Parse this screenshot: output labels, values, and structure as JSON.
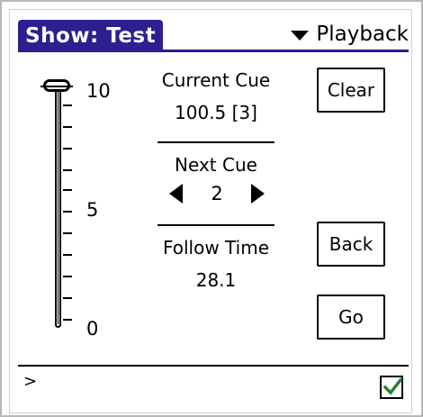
{
  "header": {
    "title": "Show: Test",
    "menu_label": "Playback",
    "accent_color": "#2c1f8f"
  },
  "slider": {
    "labels": {
      "top": "10",
      "middle": "5",
      "bottom": "0"
    },
    "value": 10,
    "min": 0,
    "max": 10
  },
  "current_cue": {
    "label": "Current Cue",
    "value": "100.5 [3]"
  },
  "next_cue": {
    "label": "Next Cue",
    "value": "2"
  },
  "follow_time": {
    "label": "Follow Time",
    "value": "28.1"
  },
  "buttons": {
    "clear": "Clear",
    "back": "Back",
    "go": "Go"
  },
  "command_line": {
    "prompt": ">"
  },
  "checkbox": {
    "checked": true,
    "check_color": "#2e7d32"
  }
}
